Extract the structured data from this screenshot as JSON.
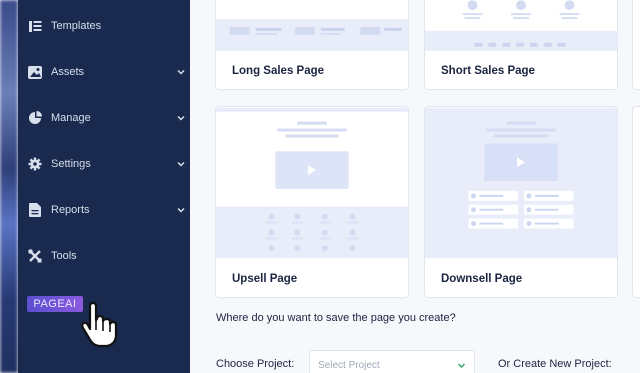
{
  "sidebar": {
    "items": [
      {
        "label": "Templates",
        "icon": "templates-icon",
        "has_chevron": false
      },
      {
        "label": "Assets",
        "icon": "assets-icon",
        "has_chevron": true
      },
      {
        "label": "Manage",
        "icon": "manage-icon",
        "has_chevron": true
      },
      {
        "label": "Settings",
        "icon": "gear-icon",
        "has_chevron": true
      },
      {
        "label": "Reports",
        "icon": "reports-icon",
        "has_chevron": true
      },
      {
        "label": "Tools",
        "icon": "tools-icon",
        "has_chevron": false
      }
    ],
    "badge": "PAGEAI"
  },
  "templates": [
    {
      "label": "Long Sales Page"
    },
    {
      "label": "Short Sales Page"
    },
    {
      "label": "Upsell Page"
    },
    {
      "label": "Downsell Page"
    }
  ],
  "save_section": {
    "question": "Where do you want to save the page you create?",
    "choose_label": "Choose Project:",
    "select_placeholder": "Select Project",
    "create_label": "Or Create New Project:"
  },
  "colors": {
    "sidebar_bg": "#192a4e",
    "accent": "#6b5ad8",
    "preview_block": "#e6ebfa"
  }
}
